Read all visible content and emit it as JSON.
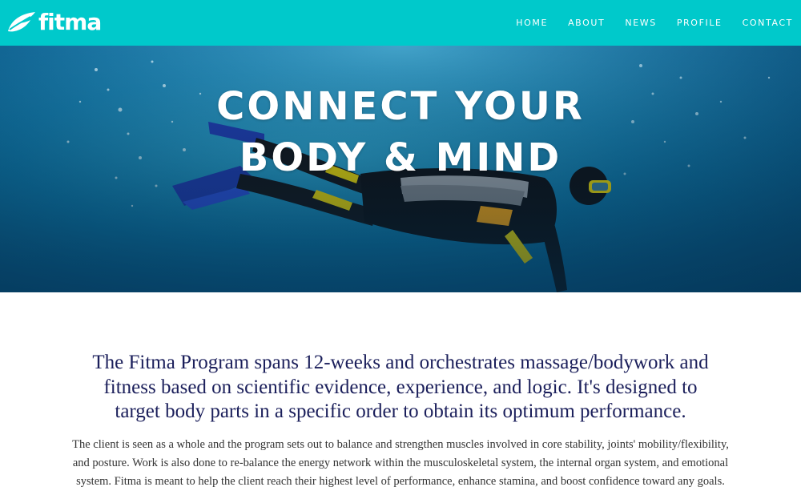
{
  "brand": {
    "name": "fitma",
    "logo_icon": "leaf-swoosh-icon"
  },
  "nav": {
    "items": [
      {
        "label": "HOME"
      },
      {
        "label": "ABOUT"
      },
      {
        "label": "NEWS"
      },
      {
        "label": "PROFILE"
      },
      {
        "label": "CONTACT"
      }
    ]
  },
  "hero": {
    "title_line1": "CONNECT YOUR",
    "title_line2": "BODY & MIND",
    "image": "scuba-diver-underwater"
  },
  "content": {
    "lead": "The Fitma Program spans 12-weeks and orchestrates massage/bodywork and fitness based on scientific evidence, experience, and logic. It's designed to target body parts in a specific order to obtain its optimum performance.",
    "body": "The client is seen as a whole and the program sets out to balance and strengthen muscles involved in core stability, joints' mobility/flexibility, and posture. Work is also done to re-balance the energy network within the musculoskeletal system, the internal organ system, and emotional system. Fitma is meant to help the client reach their highest level of performance, enhance stamina, and boost confidence toward any goals."
  },
  "colors": {
    "header_bg": "#00c9cb",
    "lead_text": "#1b1f5b",
    "body_text": "#333333"
  }
}
